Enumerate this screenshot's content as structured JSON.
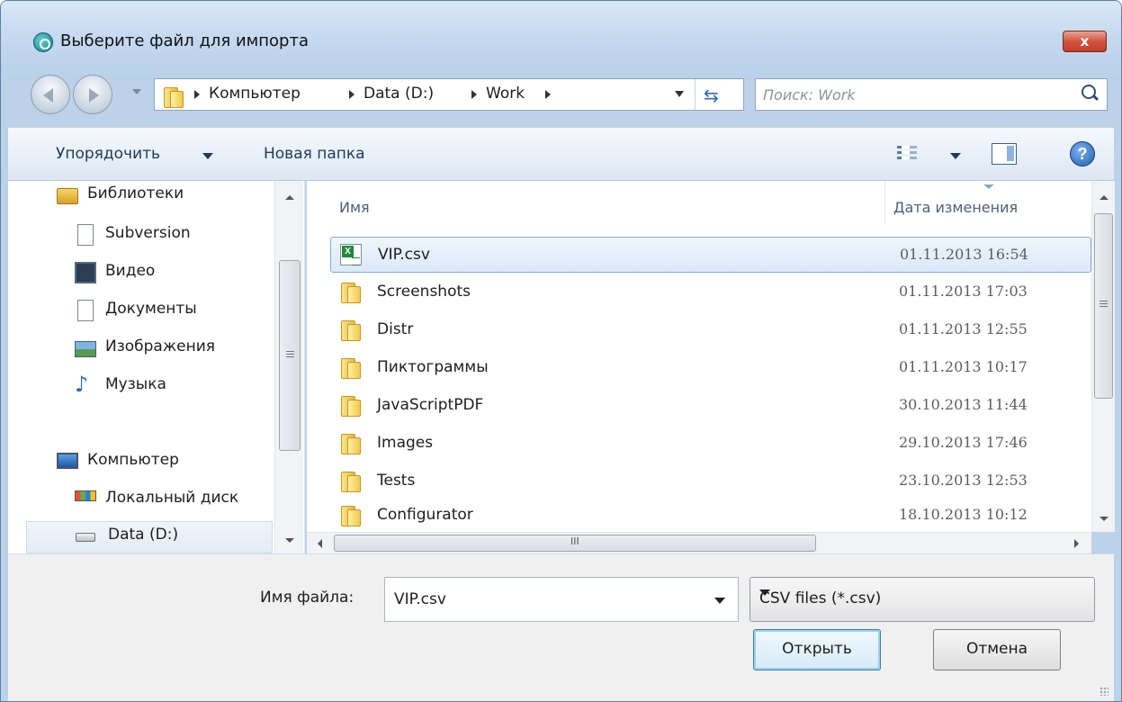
{
  "window": {
    "title": "Выберите файл для импорта",
    "close_label": "x"
  },
  "address": {
    "crumbs": [
      "Компьютер",
      "Data (D:)",
      "Work"
    ]
  },
  "search": {
    "placeholder": "Поиск: Work"
  },
  "toolbar": {
    "organize_label": "Упорядочить",
    "new_folder_label": "Новая папка",
    "help_label": "?"
  },
  "nav_tree": {
    "items": [
      {
        "label": "Библиотеки",
        "icon": "libraries-icon"
      },
      {
        "label": "Subversion",
        "icon": "document-icon"
      },
      {
        "label": "Видео",
        "icon": "video-icon"
      },
      {
        "label": "Документы",
        "icon": "documents-icon"
      },
      {
        "label": "Изображения",
        "icon": "pictures-icon"
      },
      {
        "label": "Музыка",
        "icon": "music-icon"
      },
      {
        "label": "Компьютер",
        "icon": "computer-icon"
      },
      {
        "label": "Локальный диск",
        "icon": "local-disk-icon"
      },
      {
        "label": "Data (D:)",
        "icon": "drive-icon"
      }
    ],
    "selected": "Data (D:)"
  },
  "file_list": {
    "columns": {
      "name": "Имя",
      "date": "Дата изменения"
    },
    "rows": [
      {
        "name": "VIP.csv",
        "date": "01.11.2013 16:54",
        "type": "csv-file-icon",
        "selected": true
      },
      {
        "name": "Screenshots",
        "date": "01.11.2013 17:03",
        "type": "folder-icon"
      },
      {
        "name": "Distr",
        "date": "01.11.2013 12:55",
        "type": "folder-icon"
      },
      {
        "name": "Пиктограммы",
        "date": "01.11.2013 10:17",
        "type": "folder-icon"
      },
      {
        "name": "JavaScriptPDF",
        "date": "30.10.2013 11:44",
        "type": "folder-icon"
      },
      {
        "name": "Images",
        "date": "29.10.2013 17:46",
        "type": "folder-icon"
      },
      {
        "name": "Tests",
        "date": "23.10.2013 12:53",
        "type": "folder-icon"
      },
      {
        "name": "Configurator",
        "date": "18.10.2013 10:12",
        "type": "folder-icon"
      }
    ]
  },
  "bottom": {
    "filename_label": "Имя файла:",
    "filename_value": "VIP.csv",
    "filter_value": "CSV files (*.csv)",
    "open_label": "Открыть",
    "cancel_label": "Отмена"
  },
  "scroll": {
    "h_grip": "III"
  },
  "colors": {
    "selection_border": "#84acdd",
    "title_gradient_top": "#d9e8f7",
    "close_button": "#c03d28"
  }
}
